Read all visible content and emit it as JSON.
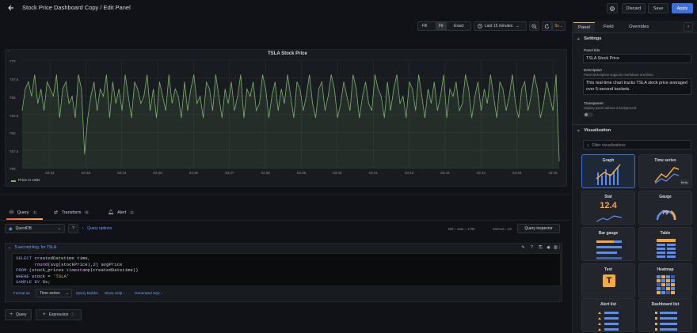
{
  "header": {
    "title": "Stock Price Dashboard Copy / Edit Panel",
    "discard_label": "Discard",
    "save_label": "Save",
    "apply_label": "Apply"
  },
  "toolbar": {
    "fill_label": "Fill",
    "fit_label": "Fit",
    "exact_label": "Exact",
    "time_range": "Last 15 minutes",
    "refresh_interval": "5s"
  },
  "panel": {
    "title": "TSLA Stock Price",
    "legend_series": "Price in USD"
  },
  "chart_data": {
    "type": "line",
    "title": "TSLA Stock Price",
    "series": [
      {
        "name": "Price in USD",
        "color": "#7eb26d",
        "values": [
          763,
          766,
          767,
          765,
          768,
          764,
          766,
          763,
          767,
          766,
          765,
          768,
          762,
          766,
          767,
          764,
          765,
          762,
          768,
          766,
          757,
          762,
          765,
          767,
          763,
          766,
          765,
          768,
          762,
          767,
          764,
          766,
          763,
          768,
          765,
          762,
          767,
          766,
          764,
          765,
          768,
          763,
          766,
          762,
          767,
          765,
          763,
          768,
          764,
          766,
          765,
          762,
          767,
          763,
          766,
          768,
          764,
          765,
          762,
          767,
          766,
          763,
          768,
          765,
          762,
          766,
          764,
          767,
          763,
          765,
          768,
          762,
          766,
          765,
          767,
          763,
          764,
          768,
          766,
          762,
          765,
          767,
          763,
          766,
          764,
          768,
          765,
          762,
          767,
          766,
          763,
          765,
          768,
          764,
          762,
          766,
          767,
          763,
          765,
          768,
          766,
          762,
          764,
          767,
          765,
          763,
          768,
          766,
          762,
          765,
          767,
          764,
          763,
          768,
          766,
          765,
          762,
          767,
          763,
          766,
          768,
          764,
          765,
          762,
          767,
          766,
          763,
          768,
          765,
          762,
          766,
          764,
          767,
          763,
          765,
          768,
          762,
          766,
          765,
          767,
          763,
          764,
          768,
          766,
          762,
          765,
          767,
          763,
          766,
          764,
          768,
          765,
          762,
          767,
          766,
          763,
          765,
          768,
          764,
          762,
          766,
          767,
          763,
          765,
          768,
          766,
          762,
          764,
          767,
          765,
          763,
          768,
          756
        ]
      }
    ],
    "x_ticks": [
      "03:32",
      "03:33",
      "03:34",
      "03:35",
      "03:36",
      "03:37",
      "03:38",
      "03:39",
      "03:40",
      "03:41",
      "03:42",
      "03:43",
      "03:44",
      "03:45",
      "03:46"
    ],
    "y_ticks": [
      "770",
      "767.5",
      "765",
      "762.5",
      "760",
      "757.5",
      "755"
    ],
    "ylim": [
      755,
      770
    ],
    "grid": true,
    "legend_position": "bottom-left"
  },
  "query_section": {
    "tabs": [
      {
        "label": "Query",
        "count": "1"
      },
      {
        "label": "Transform",
        "count": "0"
      },
      {
        "label": "Alert",
        "count": "1"
      }
    ],
    "datasource": "QuestDB",
    "query_options_label": "Query options",
    "meta_text": "MD = auto = 1790",
    "interval_text": "Interval = 1m",
    "inspector_label": "Query inspector",
    "query_name": "5-second Avg. for TSLA",
    "sql_lines": [
      "SELECT createdDatetime time,",
      "       round(avg(stockPrice),2) avgPrice",
      "FROM (stock_prices timestamp(createdDatetime))",
      "WHERE stock = 'TSLA'",
      "SAMPLE BY 5s;"
    ],
    "format_as_label": "Format as",
    "format_value": "Time series",
    "query_builder_label": "Query Builder",
    "show_help_label": "Show Help ›",
    "generated_sql_label": "Generated SQL ›",
    "add_query_label": "Query",
    "add_expression_label": "Expression"
  },
  "right_pane": {
    "tabs": [
      "Panel",
      "Field",
      "Overrides"
    ],
    "settings_label": "Settings",
    "panel_title_label": "Panel title",
    "panel_title_value": "TSLA Stock Price",
    "description_label": "Description",
    "description_hint": "Panel description supports markdown and links.",
    "description_value": "This real-time chart tracks TSLA stock price averaged over 5-second buckets.",
    "transparent_label": "Transparent",
    "transparent_hint": "Display panel without a background.",
    "visualization_label": "Visualization",
    "filter_placeholder": "Filter visualizations",
    "visualizations": [
      {
        "label": "Graph"
      },
      {
        "label": "Time series",
        "badge": "Beta"
      },
      {
        "label": "Stat",
        "value": "12.4"
      },
      {
        "label": "Gauge",
        "value": "79"
      },
      {
        "label": "Bar gauge"
      },
      {
        "label": "Table"
      },
      {
        "label": "Text",
        "glyph": "T"
      },
      {
        "label": "Heatmap"
      },
      {
        "label": "Alert list"
      },
      {
        "label": "Dashboard list"
      }
    ]
  },
  "colors": {
    "accent": "#3d71d9",
    "series": "#7eb26d",
    "background": "#111217"
  }
}
